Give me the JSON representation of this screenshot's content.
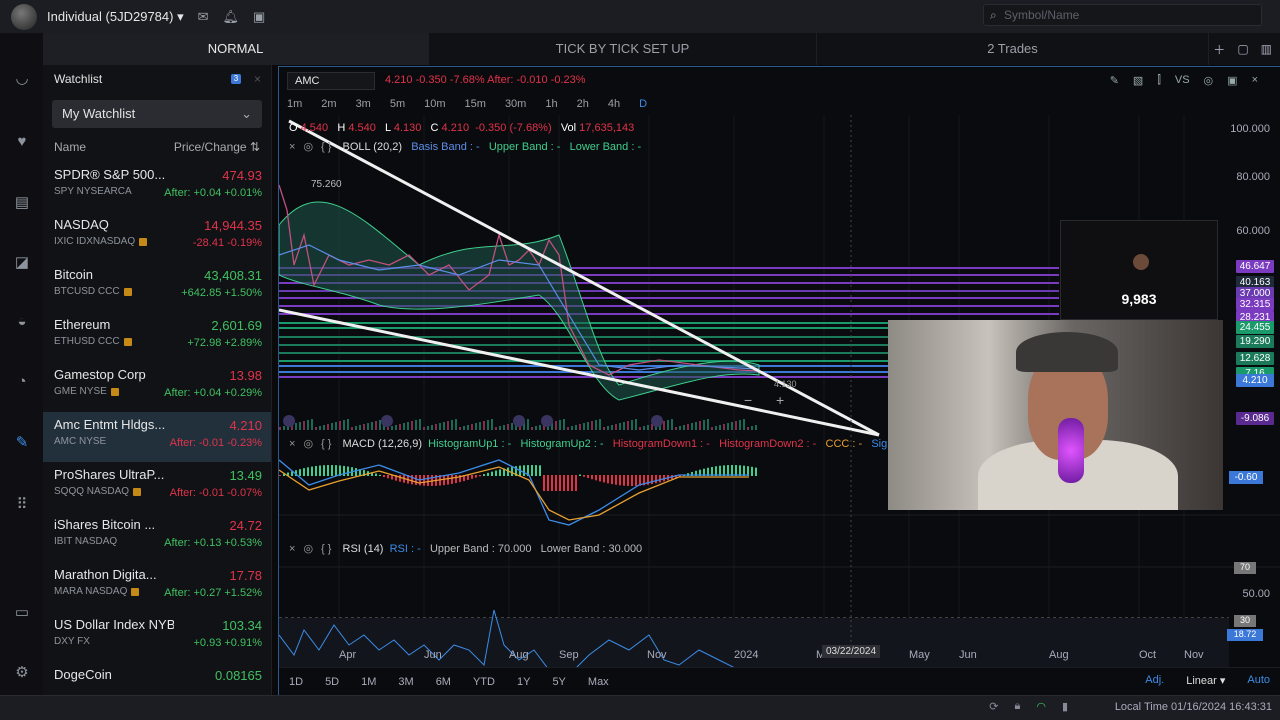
{
  "account": {
    "name": "Individual (5JD29784)"
  },
  "search": {
    "placeholder": "Symbol/Name"
  },
  "tabs": [
    {
      "label": "NORMAL"
    },
    {
      "label": "TICK BY TICK SET UP"
    },
    {
      "label": "2 Trades"
    }
  ],
  "watchlist": {
    "title": "Watchlist",
    "badge": "3",
    "selected_list": "My Watchlist",
    "col_name": "Name",
    "col_price": "Price/Change",
    "items": [
      {
        "name": "SPDR® S&P 500...",
        "price": "474.93",
        "price_dir": "down",
        "sub": "SPY NYSEARCA",
        "change": "After: +0.04 +0.01%",
        "change_dir": "up",
        "icon": false
      },
      {
        "name": "NASDAQ",
        "price": "14,944.35",
        "price_dir": "down",
        "sub": "IXIC IDXNASDAQ",
        "change": "-28.41 -0.19%",
        "change_dir": "down",
        "icon": true
      },
      {
        "name": "Bitcoin",
        "price": "43,408.31",
        "price_dir": "up",
        "sub": "BTCUSD CCC",
        "change": "+642.85 +1.50%",
        "change_dir": "up",
        "icon": true
      },
      {
        "name": "Ethereum",
        "price": "2,601.69",
        "price_dir": "up",
        "sub": "ETHUSD CCC",
        "change": "+72.98 +2.89%",
        "change_dir": "up",
        "icon": true
      },
      {
        "name": "Gamestop Corp",
        "price": "13.98",
        "price_dir": "down",
        "sub": "GME NYSE",
        "change": "After: +0.04 +0.29%",
        "change_dir": "up",
        "icon": true
      },
      {
        "name": "Amc Entmt Hldgs...",
        "price": "4.210",
        "price_dir": "down",
        "sub": "AMC NYSE",
        "change": "After: -0.01 -0.23%",
        "change_dir": "down",
        "icon": false
      },
      {
        "name": "ProShares UltraP...",
        "price": "13.49",
        "price_dir": "up",
        "sub": "SQQQ NASDAQ",
        "change": "After: -0.01 -0.07%",
        "change_dir": "down",
        "icon": true
      },
      {
        "name": "iShares Bitcoin ...",
        "price": "24.72",
        "price_dir": "down",
        "sub": "IBIT NASDAQ",
        "change": "After: +0.13 +0.53%",
        "change_dir": "up",
        "icon": false
      },
      {
        "name": "Marathon Digita...",
        "price": "17.78",
        "price_dir": "down",
        "sub": "MARA NASDAQ",
        "change": "After: +0.27 +1.52%",
        "change_dir": "up",
        "icon": true
      },
      {
        "name": "US Dollar Index NYBOT",
        "price": "103.34",
        "price_dir": "up",
        "sub": "DXY FX",
        "change": "+0.93 +0.91%",
        "change_dir": "up",
        "icon": false
      },
      {
        "name": "DogeCoin",
        "price": "0.08165",
        "price_dir": "up",
        "sub": "",
        "change": "",
        "change_dir": "up",
        "icon": false
      }
    ]
  },
  "chart": {
    "symbol": "AMC",
    "quote": "4.210  -0.350  -7.68%  After:  -0.010  -0.23%",
    "intervals": [
      "1m",
      "2m",
      "3m",
      "5m",
      "10m",
      "15m",
      "30m",
      "1h",
      "2h",
      "4h",
      "D"
    ],
    "active_interval": "D",
    "ohlc": {
      "o_label": "O",
      "o": "4.540",
      "h_label": "H",
      "h": "4.540",
      "l_label": "L",
      "l": "4.130",
      "c_label": "C",
      "c": "4.210",
      "chg": "-0.350 (-7.68%)",
      "vol_label": "Vol",
      "vol": "17,635,143"
    },
    "boll": {
      "name": "BOLL (20,2)",
      "basis": "Basis Band : -",
      "upper": "Upper Band : -",
      "lower": "Lower Band : -"
    },
    "macd": {
      "name": "MACD (12,26,9)",
      "h1": "HistogramUp1 : -",
      "h2": "HistogramUp2 : -",
      "d1": "HistogramDown1 : -",
      "d2": "HistogramDown2 : -",
      "ccc": "CCC : -",
      "sig": "Sign"
    },
    "rsi": {
      "name": "RSI (14)",
      "rsi": "RSI : -",
      "upper": "Upper Band : 70.000",
      "lower": "Lower Band : 30.000"
    },
    "price_axis": [
      "100.000",
      "80.000",
      "60.000"
    ],
    "price_labels": [
      {
        "v": "46.647",
        "color": "#7a3bc0"
      },
      {
        "v": "40.163",
        "color": "#1f2a3a"
      },
      {
        "v": "37.000",
        "color": "#6a3bb0"
      },
      {
        "v": "32.315",
        "color": "#7a3bc0"
      },
      {
        "v": "28.231",
        "color": "#7a3bc0"
      },
      {
        "v": "24.455",
        "color": "#1a9a6a"
      },
      {
        "v": "19.290",
        "color": "#1a7a5a"
      },
      {
        "v": "12.628",
        "color": "#1a7a5a"
      },
      {
        "v": "7.16",
        "color": "#1a9a6a"
      },
      {
        "v": "4.210",
        "color": "#3c78d8"
      },
      {
        "v": "-9.086",
        "color": "#5a2a90"
      }
    ],
    "high_marker": "75.260",
    "last_label": "4.130",
    "macd_value": "-0.60",
    "rsi_axis": {
      "v70": "70",
      "v50": "50.00",
      "v30": "30",
      "cur": "18.72"
    },
    "time_axis": [
      "Apr",
      "Jun",
      "Aug",
      "Sep",
      "Nov",
      "2024",
      "M",
      "May",
      "Jun",
      "Aug",
      "Oct",
      "Nov"
    ],
    "date_tip": "03/22/2024",
    "ranges": [
      "1D",
      "5D",
      "1M",
      "3M",
      "6M",
      "YTD",
      "1Y",
      "5Y",
      "Max"
    ],
    "adj": "Adj.",
    "scale": "Linear",
    "auto": "Auto"
  },
  "overlay": {
    "sub_count": "9,983"
  },
  "status": {
    "local_time": "Local Time 01/16/2024 16:43:31"
  }
}
